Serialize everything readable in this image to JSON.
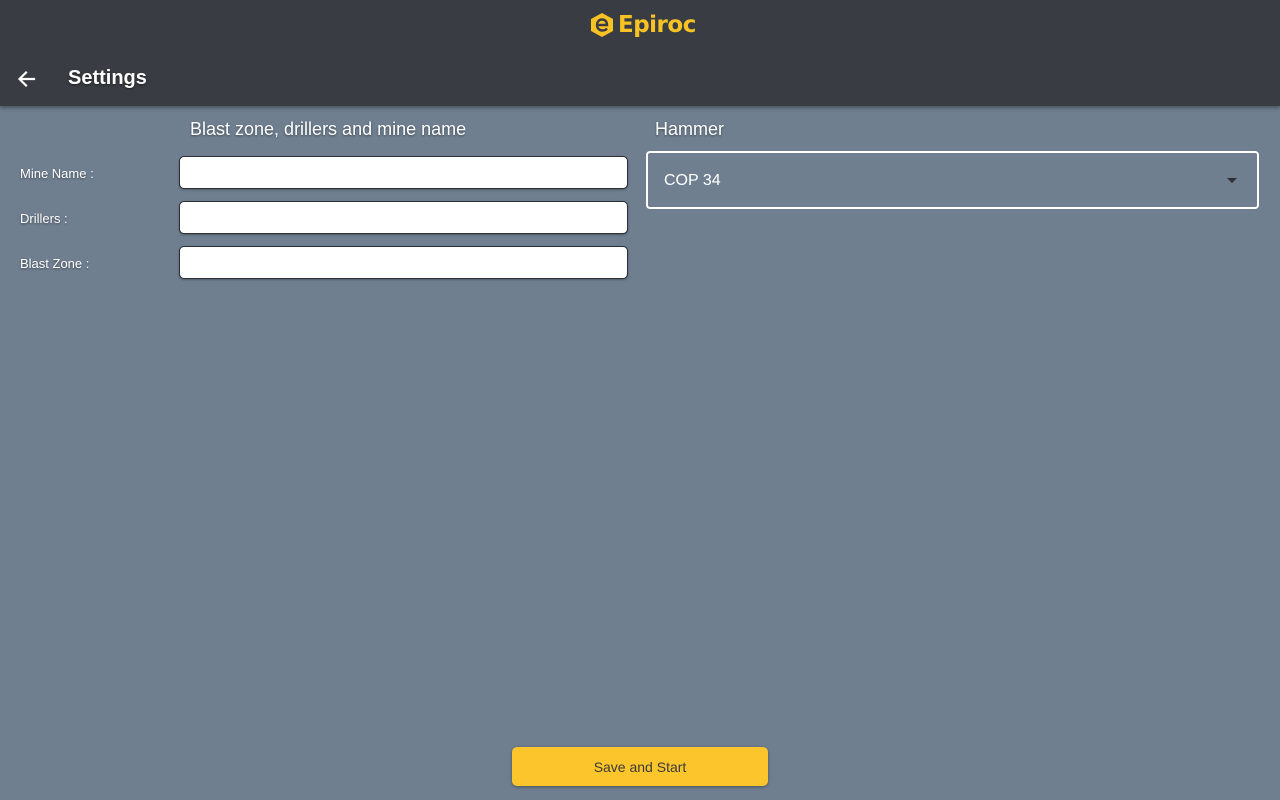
{
  "header": {
    "brand": "Epiroc",
    "brand_color": "#f7c324",
    "title": "Settings",
    "back_icon": "arrow-left-icon"
  },
  "left_section": {
    "title": "Blast zone, drillers and mine name",
    "fields": [
      {
        "label": "Mine Name :",
        "value": "",
        "placeholder": ""
      },
      {
        "label": "Drillers :",
        "value": "",
        "placeholder": ""
      },
      {
        "label": "Blast Zone :",
        "value": "",
        "placeholder": ""
      }
    ]
  },
  "right_section": {
    "title": "Hammer",
    "hammer_select": {
      "selected": "COP 34",
      "icon": "caret-down-icon"
    }
  },
  "footer": {
    "save_label": "Save and Start",
    "save_color": "#fcc52b"
  },
  "colors": {
    "background": "#6f7f90",
    "topbar": "#393c42"
  }
}
